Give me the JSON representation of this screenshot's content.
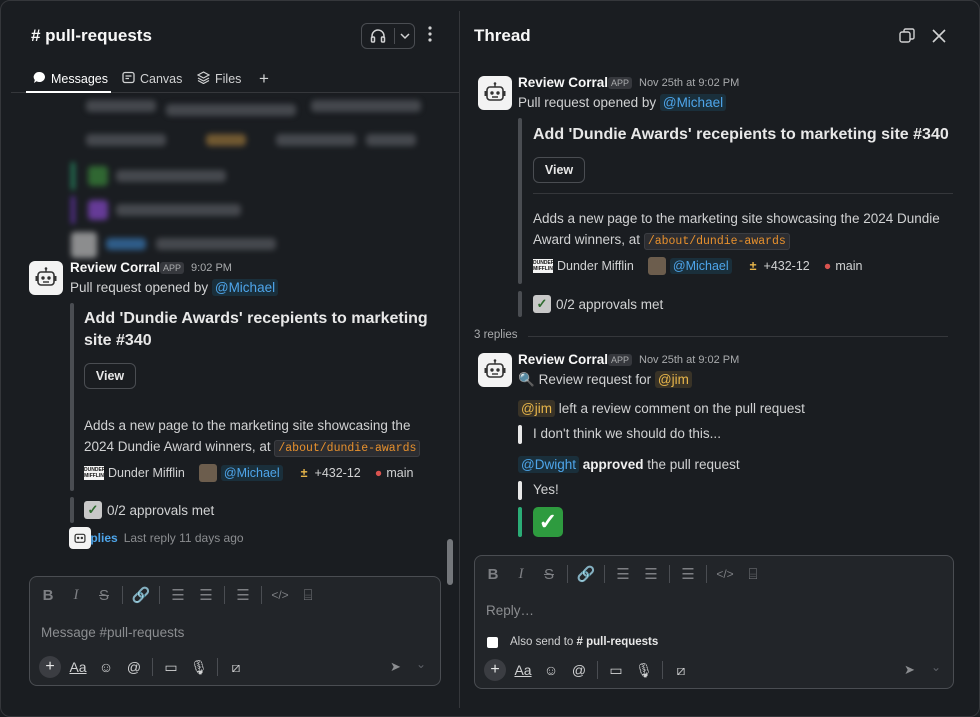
{
  "channel": {
    "title": "# pull-requests",
    "tabs": [
      {
        "label": "Messages"
      },
      {
        "label": "Canvas"
      },
      {
        "label": "Files"
      }
    ],
    "add_tab": "+",
    "message": {
      "author": "Review Corral",
      "badge": "APP",
      "time": "9:02 PM",
      "opened_by": "Pull request opened by ",
      "mention": "@Michael",
      "card_title": "Add 'Dundie Awards' recepients to marketing site #340",
      "view_label": "View",
      "desc_prefix": "Adds a new page to the marketing site showcasing the 2024 Dundie Award winners, at ",
      "desc_code": "/about/dundie-awards",
      "org": "Dunder Mifflin",
      "org_logo": "DUNDER MIFFLIN",
      "author_mention": "@Michael",
      "diff_icon": "±",
      "diff": "+432-12",
      "branch": "main",
      "approvals": "0/2 approvals met",
      "replies_link": "3 replies",
      "last_reply": "Last reply 11 days ago"
    },
    "composer": {
      "placeholder": "Message #pull-requests"
    }
  },
  "thread": {
    "title": "Thread",
    "root": {
      "author": "Review Corral",
      "badge": "APP",
      "time": "Nov 25th at 9:02 PM",
      "opened_by": "Pull request opened by ",
      "mention": "@Michael",
      "card_title": "Add 'Dundie Awards' recepients to marketing site #340",
      "view_label": "View",
      "desc_prefix": "Adds a new page to the marketing site showcasing the 2024 Dundie Award winners, at ",
      "desc_code": "/about/dundie-awards",
      "org": "Dunder Mifflin",
      "org_logo": "DUNDER MIFFLIN",
      "author_mention": "@Michael",
      "diff_icon": "±",
      "diff": "+432-12",
      "branch": "main",
      "approvals": "0/2 approvals met"
    },
    "replies_count": "3 replies",
    "reply": {
      "author": "Review Corral",
      "badge": "APP",
      "time": "Nov 25th at 9:02 PM",
      "review_request_text": "Review request for ",
      "review_request_mention": "@jim",
      "comment_mention": "@jim",
      "comment_text": " left a review comment on the pull request",
      "comment_quote": "I don't think we should do this...",
      "approve_mention": "@Dwight",
      "approve_bold": "approved",
      "approve_text": " the pull request",
      "approve_quote": "Yes!"
    },
    "composer": {
      "placeholder": "Reply…",
      "also_send_prefix": "Also send to ",
      "also_send_channel": "# pull-requests"
    }
  },
  "icons": {
    "headphones": "headphones-icon",
    "kebab": "more-vertical-icon",
    "messages": "message-bubble-icon",
    "canvas": "canvas-icon",
    "files": "files-icon",
    "popout": "popout-icon",
    "close": "close-icon",
    "magnifier": "🔍"
  },
  "colors": {
    "background": "#1a1d21",
    "link": "#4ea5ea",
    "mention_jim": "#e8b64a",
    "code": "#e8912d",
    "approve_bar": "#2bac76"
  }
}
